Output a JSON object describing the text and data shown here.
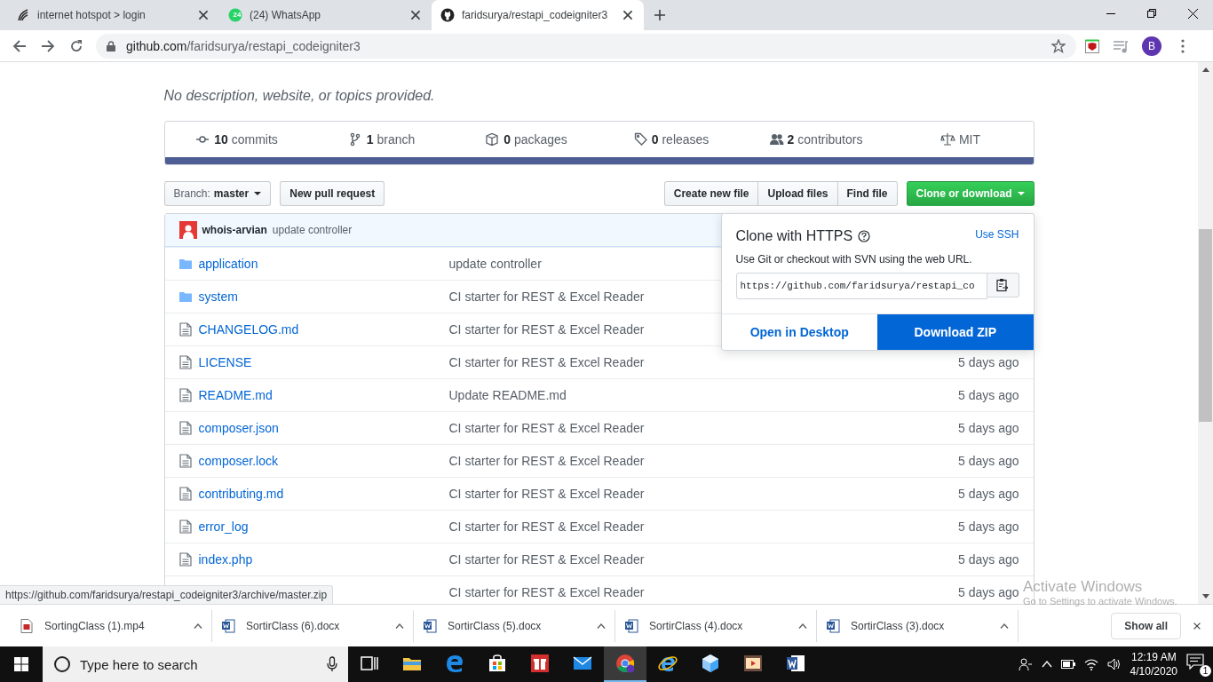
{
  "browser": {
    "tabs": [
      {
        "kind": "hotspot",
        "title": "internet hotspot > login",
        "selected": false
      },
      {
        "kind": "whatsapp",
        "title": "(24) WhatsApp",
        "badge": "24",
        "selected": false
      },
      {
        "kind": "github",
        "title": "faridsurya/restapi_codeigniter3",
        "selected": true
      }
    ],
    "address": {
      "host": "github.com",
      "path": "/faridsurya/restapi_codeigniter3"
    },
    "profile_initial": "B"
  },
  "repo": {
    "description": "No description, website, or topics provided.",
    "stats": [
      {
        "kind": "commits",
        "count": "10",
        "label": "commits"
      },
      {
        "kind": "branch",
        "count": "1",
        "label": "branch"
      },
      {
        "kind": "packages",
        "count": "0",
        "label": "packages"
      },
      {
        "kind": "releases",
        "count": "0",
        "label": "releases"
      },
      {
        "kind": "contributors",
        "count": "2",
        "label": "contributors"
      },
      {
        "kind": "license",
        "label": "MIT"
      }
    ],
    "branch_button": {
      "prefix": "Branch:",
      "value": "master"
    },
    "new_pull_request": "New pull request",
    "file_buttons": [
      "Create new file",
      "Upload files",
      "Find file"
    ],
    "clone_button": "Clone or download",
    "commit": {
      "author": "whois-arvian",
      "message": "update controller"
    },
    "files": [
      {
        "kind": "dir",
        "name": "application",
        "message": "update controller"
      },
      {
        "kind": "dir",
        "name": "system",
        "message": "CI starter for REST & Excel Reader"
      },
      {
        "kind": "file",
        "name": "CHANGELOG.md",
        "message": "CI starter for REST & Excel Reader"
      },
      {
        "kind": "file",
        "name": "LICENSE",
        "message": "CI starter for REST & Excel Reader",
        "age": "5 days ago"
      },
      {
        "kind": "file",
        "name": "README.md",
        "message": "Update README.md",
        "age": "5 days ago"
      },
      {
        "kind": "file",
        "name": "composer.json",
        "message": "CI starter for REST & Excel Reader",
        "age": "5 days ago"
      },
      {
        "kind": "file",
        "name": "composer.lock",
        "message": "CI starter for REST & Excel Reader",
        "age": "5 days ago"
      },
      {
        "kind": "file",
        "name": "contributing.md",
        "message": "CI starter for REST & Excel Reader",
        "age": "5 days ago"
      },
      {
        "kind": "file",
        "name": "error_log",
        "message": "CI starter for REST & Excel Reader",
        "age": "5 days ago"
      },
      {
        "kind": "file",
        "name": "index.php",
        "message": "CI starter for REST & Excel Reader",
        "age": "5 days ago"
      },
      {
        "kind": "hidden",
        "message": "CI starter for REST & Excel Reader",
        "age": "5 days ago"
      }
    ],
    "clone_popup": {
      "title": "Clone with HTTPS",
      "use_ssh": "Use SSH",
      "hint": "Use Git or checkout with SVN using the web URL.",
      "url": "https://github.com/faridsurya/restapi_co",
      "open_desktop": "Open in Desktop",
      "download_zip": "Download ZIP"
    }
  },
  "status_url": "https://github.com/faridsurya/restapi_codeigniter3/archive/master.zip",
  "windows_activation": {
    "title": "Activate Windows",
    "hint": "Go to Settings to activate Windows."
  },
  "downloads": {
    "items": [
      {
        "kind": "video",
        "name": "SortingClass (1).mp4"
      },
      {
        "kind": "word",
        "name": "SortirClass (6).docx"
      },
      {
        "kind": "word",
        "name": "SortirClass (5).docx"
      },
      {
        "kind": "word",
        "name": "SortirClass (4).docx"
      },
      {
        "kind": "word",
        "name": "SortirClass (3).docx"
      }
    ],
    "show_all": "Show all"
  },
  "taskbar": {
    "search_placeholder": "Type here to search",
    "apps": [
      {
        "kind": "taskview",
        "selected": false
      },
      {
        "kind": "explorer",
        "selected": false
      },
      {
        "kind": "edge",
        "selected": false
      },
      {
        "kind": "store",
        "selected": false
      },
      {
        "kind": "gift",
        "selected": false
      },
      {
        "kind": "mail",
        "selected": false
      },
      {
        "kind": "chrome",
        "selected": true
      },
      {
        "kind": "ie",
        "selected": false
      },
      {
        "kind": "cube",
        "selected": false
      },
      {
        "kind": "video",
        "selected": false
      },
      {
        "kind": "word",
        "selected": false
      }
    ],
    "time": "12:19 AM",
    "date": "4/10/2020",
    "notification_count": "1"
  }
}
